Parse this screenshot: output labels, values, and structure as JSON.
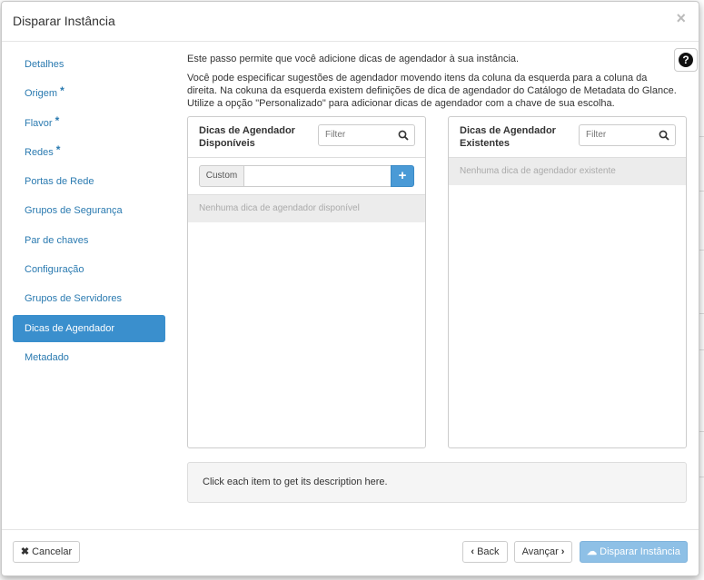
{
  "window": {
    "title": "Disparar Instância",
    "close_glyph": "×"
  },
  "sidebar": {
    "items": [
      {
        "label": "Detalhes",
        "required": false
      },
      {
        "label": "Origem",
        "required": true
      },
      {
        "label": "Flavor",
        "required": true
      },
      {
        "label": "Redes",
        "required": true
      },
      {
        "label": "Portas de Rede",
        "required": false
      },
      {
        "label": "Grupos de Segurança",
        "required": false
      },
      {
        "label": "Par de chaves",
        "required": false
      },
      {
        "label": "Configuração",
        "required": false
      },
      {
        "label": "Grupos de Servidores",
        "required": false
      },
      {
        "label": "Dicas de Agendador",
        "required": false,
        "active": true
      },
      {
        "label": "Metadado",
        "required": false
      }
    ],
    "required_marker": "*"
  },
  "help": {
    "glyph": "?",
    "icon": "question-circle-icon"
  },
  "intro": {
    "line1": "Este passo permite que você adicione dicas de agendador à sua instância.",
    "line2": "Você pode especificar sugestões de agendador movendo itens da coluna da esquerda para a coluna da direita. Na cokuna da esquerda existem definições de dica de agendador do Catálogo de Metadata do Glance. Utilize a opção \"Personalizado\" para adicionar dicas de agendador com a chave de sua escolha."
  },
  "available": {
    "title": "Dicas de Agendador Disponíveis",
    "filter_placeholder": "Filter",
    "custom_label": "Custom",
    "add_glyph": "+",
    "empty_text": "Nenhuma dica de agendador disponível"
  },
  "existing": {
    "title": "Dicas de Agendador Existentes",
    "filter_placeholder": "Filter",
    "empty_text": "Nenhuma dica de agendador existente"
  },
  "description": {
    "text": "Click each item to get its description here."
  },
  "footer": {
    "cancel_label": "Cancelar",
    "back_label": "Back",
    "next_label": "Avançar",
    "launch_label": "Disparar Instância"
  },
  "colors": {
    "accent": "#3a8fcd",
    "link": "#2a7ab0",
    "launch": "#8ec0e6"
  }
}
